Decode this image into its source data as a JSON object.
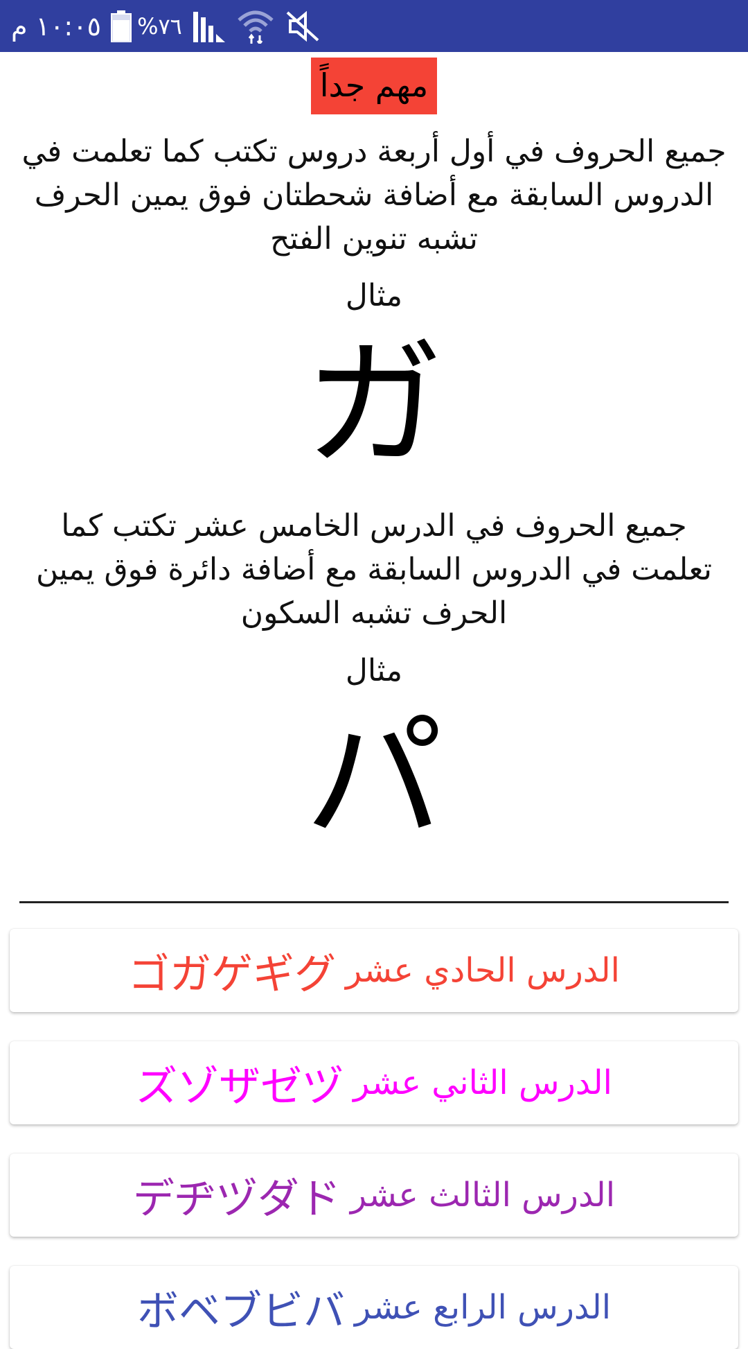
{
  "status_bar": {
    "time": "١٠:٠٥ م",
    "battery_percent": "%٧٦",
    "background_color": "#303f9f",
    "icons": [
      "battery-icon",
      "signal-icon",
      "wifi-icon",
      "mute-icon"
    ]
  },
  "header": {
    "important_label": "مهم جداً",
    "important_color": "#f44336"
  },
  "sections": [
    {
      "paragraph": "جميع الحروف في أول أربعة دروس تكتب كما تعلمت في الدروس السابقة مع أضافة شحطتان فوق يمين الحرف تشبه تنوين الفتح",
      "example_label": "مثال",
      "example_kana": "ガ"
    },
    {
      "paragraph": "جميع الحروف في الدرس الخامس عشر تكتب كما تعلمت في الدروس السابقة مع أضافة دائرة فوق يمين الحرف تشبه السكون",
      "example_label": "مثال",
      "example_kana": "パ"
    }
  ],
  "divider_text": "",
  "lessons": [
    {
      "label": "الدرس الحادي عشر",
      "kana": "ゴガゲギグ",
      "color": "#f44336"
    },
    {
      "label": "الدرس الثاني عشر",
      "kana": "ズゾザゼヅ",
      "color": "#ff00ff"
    },
    {
      "label": "الدرس الثالث عشر",
      "kana": "デヂヅダド",
      "color": "#9c27b0"
    },
    {
      "label": "الدرس الرابع عشر",
      "kana": "ボベブビバ",
      "color": "#3f51b5"
    }
  ]
}
